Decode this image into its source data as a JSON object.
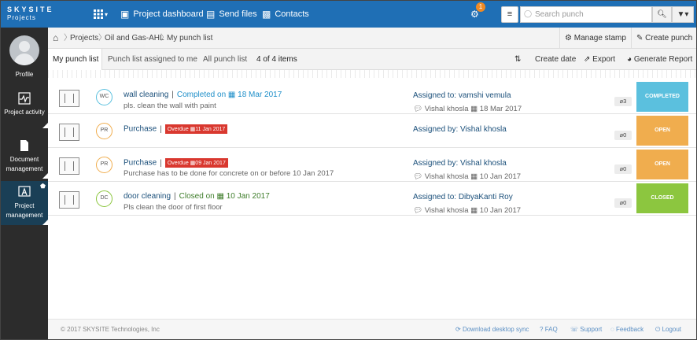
{
  "app": {
    "logo_top": "SKYSITE",
    "logo_bottom": "Projects"
  },
  "topnav": {
    "grid_caret": "▾",
    "items": [
      {
        "label": "Project dashboard",
        "icon": "dashboard-icon"
      },
      {
        "label": "Send files",
        "icon": "send-files-icon"
      },
      {
        "label": "Contacts",
        "icon": "contacts-icon"
      }
    ],
    "notification_count": "1",
    "search_placeholder": "Search punch"
  },
  "sidebar": {
    "profile_label": "Profile",
    "items": [
      {
        "label": "Project activity",
        "icon": "activity-icon",
        "active": false
      },
      {
        "label": "Document management",
        "icon": "document-icon",
        "active": false
      },
      {
        "label": "Project management",
        "icon": "project-management-icon",
        "active": true
      }
    ]
  },
  "breadcrumb": {
    "items": [
      "Projects",
      "Oil and Gas-AHL",
      "My punch list"
    ],
    "actions": [
      "Manage stamp",
      "Create punch"
    ]
  },
  "tabs": {
    "items": [
      "My punch list",
      "Punch list assigned to me",
      "All punch list"
    ],
    "count_text": "4 of 4 items",
    "actions": [
      "Create date",
      "Export",
      "Generate Report"
    ]
  },
  "punches": [
    {
      "initials": "WC",
      "title": "wall cleaning",
      "status": "Completed on",
      "date": "18 Mar 2017",
      "status_kind": "completed",
      "desc": "pls. clean the wall with paint",
      "assign": "Assigned to: vamshi vemula",
      "meta_user": "Vishal khosla",
      "meta_date": "18 Mar 2017",
      "attach": "3",
      "flag": "COMPLETED",
      "flag_color": "#5bc0de",
      "circle_color": "#5bc0de"
    },
    {
      "initials": "PR",
      "title": "Purchase",
      "status": "Overdue",
      "date": "11 Jan 2017",
      "status_kind": "overdue",
      "desc": "",
      "assign": "Assigned by: Vishal khosla",
      "meta_user": "",
      "meta_date": "",
      "attach": "0",
      "flag": "OPEN",
      "flag_color": "#f0ad4e",
      "circle_color": "#f0ad4e"
    },
    {
      "initials": "PR",
      "title": "Purchase",
      "status": "Overdue",
      "date": "09 Jan 2017",
      "status_kind": "overdue",
      "desc": "Purchase has to be done for concrete on or before 10 Jan 2017",
      "assign": "Assigned by: Vishal khosla",
      "meta_user": "Vishal khosla",
      "meta_date": "10 Jan 2017",
      "attach": "0",
      "flag": "OPEN",
      "flag_color": "#f0ad4e",
      "circle_color": "#f0ad4e"
    },
    {
      "initials": "DC",
      "title": "door cleaning",
      "status": "Closed on",
      "date": "10 Jan 2017",
      "status_kind": "closed",
      "desc": "Pls clean the door of first floor",
      "assign": "Assigned to: DibyaKanti Roy",
      "meta_user": "Vishal khosla",
      "meta_date": "10 Jan 2017",
      "attach": "0",
      "flag": "CLOSED",
      "flag_color": "#8cc63f",
      "circle_color": "#8cc63f"
    }
  ],
  "footer": {
    "copyright": "© 2017 SKYSITE Technologies, Inc",
    "links": [
      "Download desktop sync",
      "FAQ",
      "Support",
      "Feedback",
      "Logout"
    ]
  }
}
